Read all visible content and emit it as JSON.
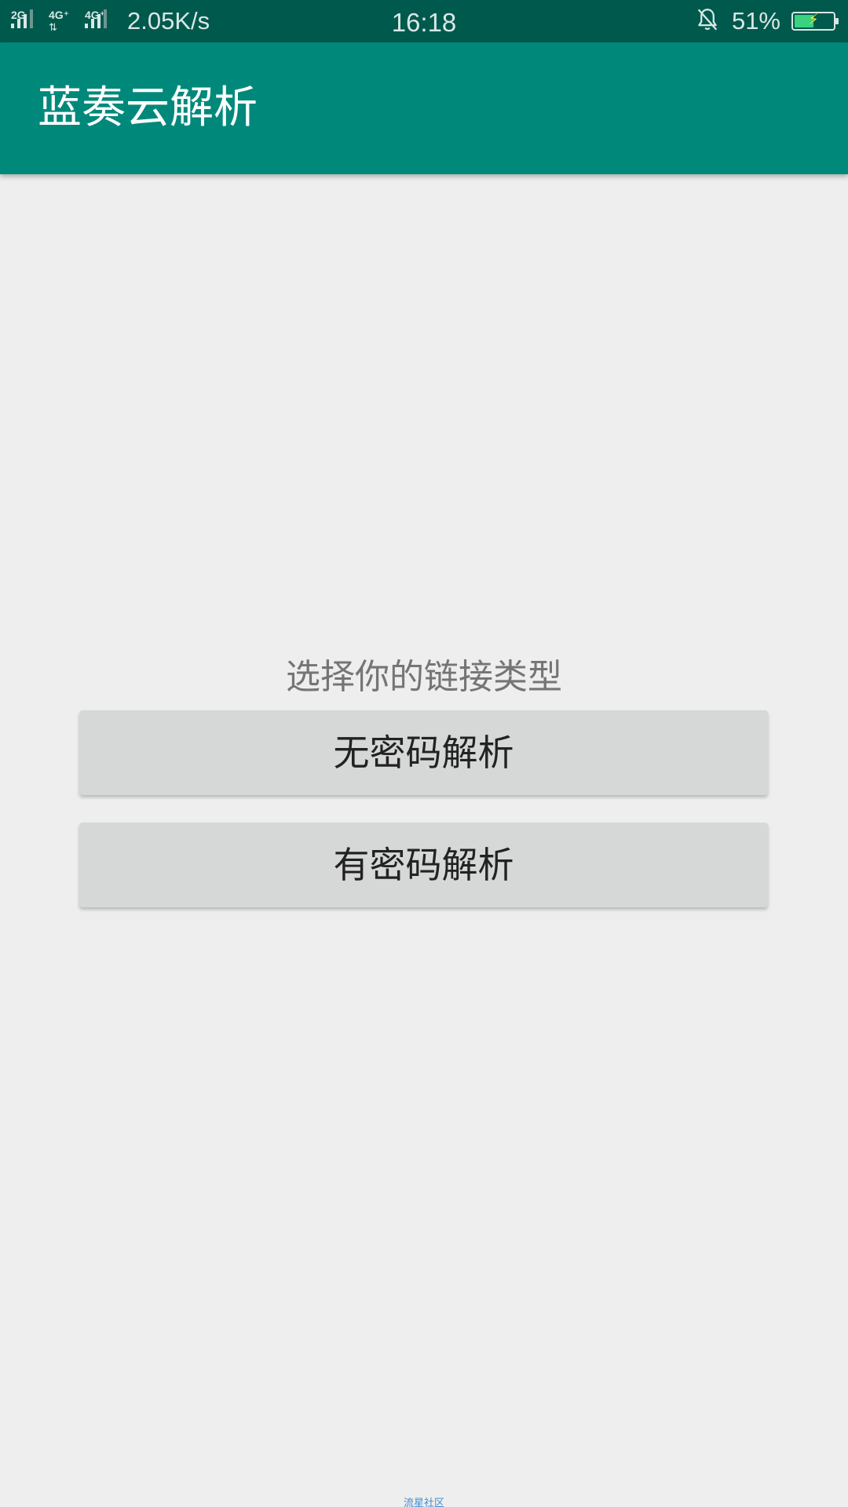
{
  "status_bar": {
    "sim1_label": "2G",
    "sim2_label": "4G⁺",
    "sim3_label": "4G⁺",
    "sim_arrows": "⇅",
    "net_speed": "2.05K/s",
    "time": "16:18",
    "battery_percent": "51%",
    "battery_level": 0.51,
    "battery_bolt": "⚡",
    "colors": {
      "background": "#00594d",
      "battery_fill": "#39d27e",
      "bolt": "#f6e33a"
    }
  },
  "app_bar": {
    "title": "蓝奏云解析",
    "color": "#00897b"
  },
  "main": {
    "prompt": "选择你的链接类型",
    "buttons": [
      {
        "label": "无密码解析"
      },
      {
        "label": "有密码解析"
      }
    ]
  },
  "footer": {
    "watermark": "流星社区"
  }
}
